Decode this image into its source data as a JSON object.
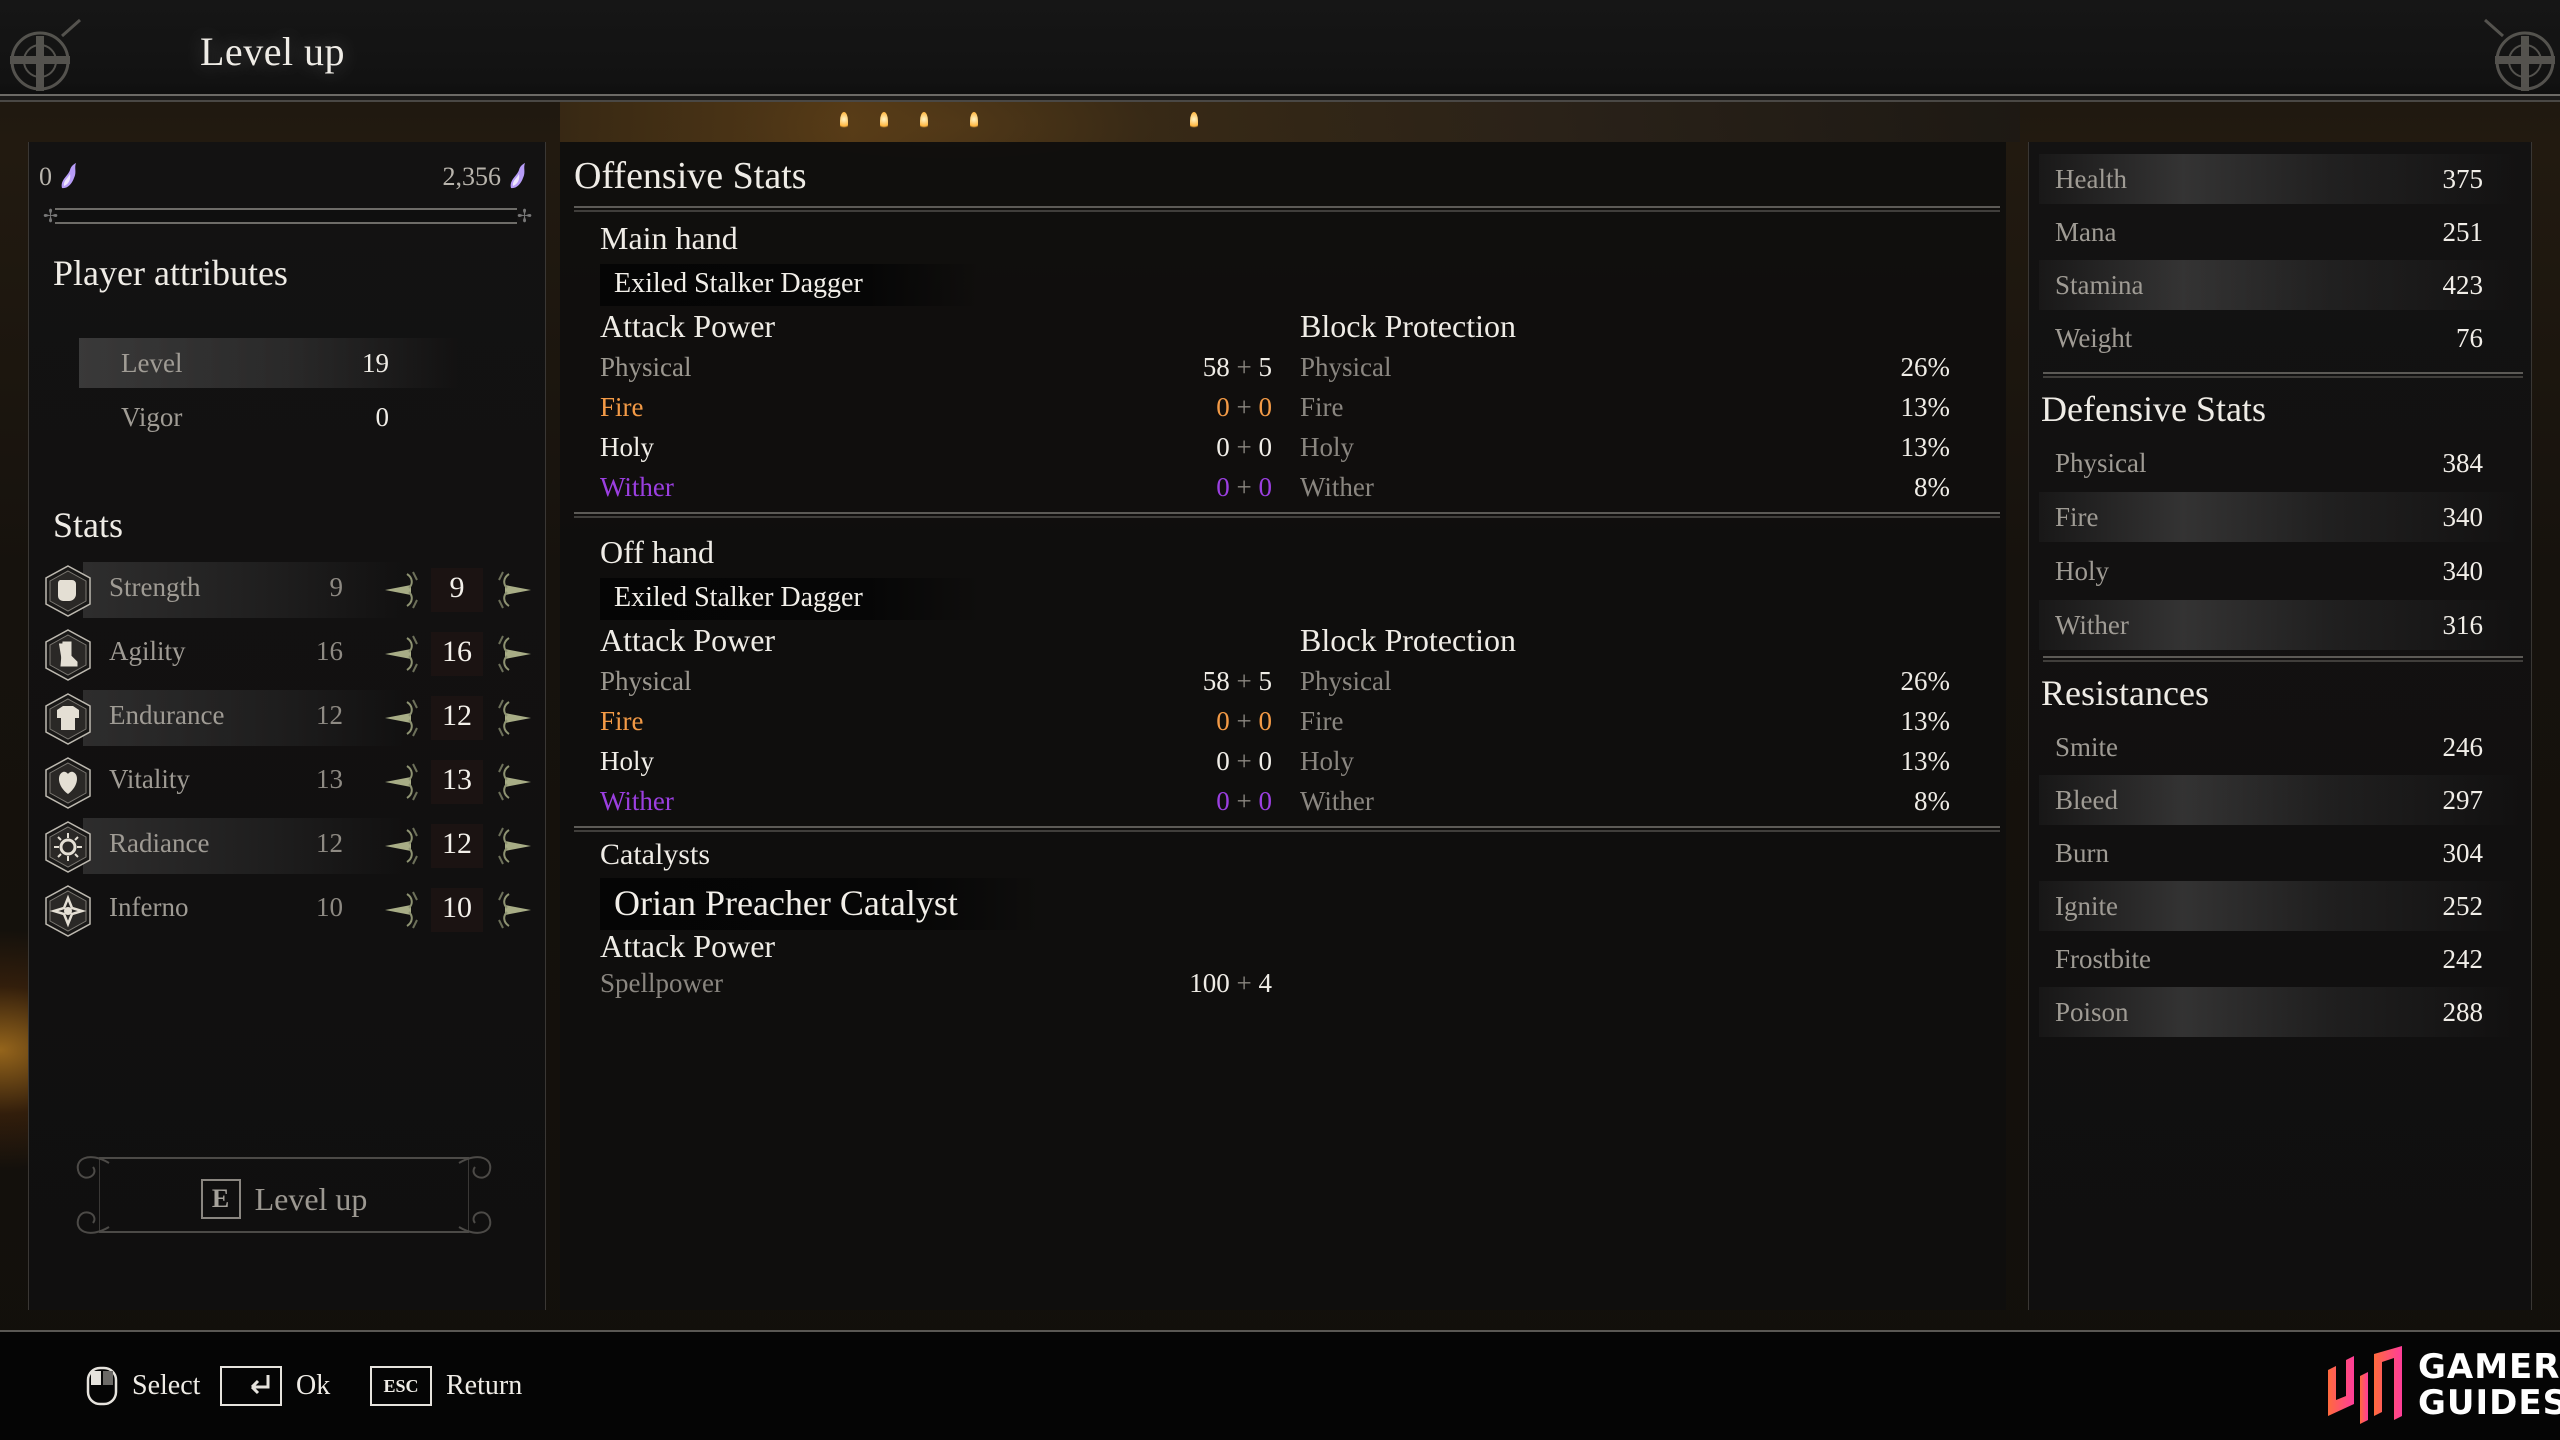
{
  "header": {
    "title": "Level up"
  },
  "currency": {
    "current_souls": "0",
    "required_souls": "2,356",
    "progress_fraction": 0.0,
    "icon": "soul-flame-icon",
    "accent": "#a98cf0"
  },
  "player_attributes": {
    "title": "Player attributes",
    "items": [
      {
        "label": "Level",
        "value": "19",
        "highlighted": true
      },
      {
        "label": "Vigor",
        "value": "0",
        "highlighted": false
      }
    ]
  },
  "stats": {
    "title": "Stats",
    "items": [
      {
        "label": "Strength",
        "base": "9",
        "current": "9",
        "icon": "fist-icon",
        "highlighted": true
      },
      {
        "label": "Agility",
        "base": "16",
        "current": "16",
        "icon": "boot-icon",
        "highlighted": false
      },
      {
        "label": "Endurance",
        "base": "12",
        "current": "12",
        "icon": "armor-icon",
        "highlighted": true
      },
      {
        "label": "Vitality",
        "base": "13",
        "current": "13",
        "icon": "heart-icon",
        "highlighted": false
      },
      {
        "label": "Radiance",
        "base": "12",
        "current": "12",
        "icon": "sun-icon",
        "highlighted": true
      },
      {
        "label": "Inferno",
        "base": "10",
        "current": "10",
        "icon": "flame-swirl-icon",
        "highlighted": false
      }
    ]
  },
  "level_up_button": {
    "key": "E",
    "label": "Level up"
  },
  "offensive": {
    "title": "Offensive Stats",
    "main_hand": {
      "title": "Main hand",
      "weapon": "Exiled Stalker Dagger",
      "attack_power_title": "Attack Power",
      "attack_power": [
        {
          "label": "Physical",
          "base": "58",
          "bonus": "5",
          "type": "physical"
        },
        {
          "label": "Fire",
          "base": "0",
          "bonus": "0",
          "type": "fire"
        },
        {
          "label": "Holy",
          "base": "0",
          "bonus": "0",
          "type": "holy"
        },
        {
          "label": "Wither",
          "base": "0",
          "bonus": "0",
          "type": "wither"
        }
      ],
      "block_title": "Block Protection",
      "block": [
        {
          "label": "Physical",
          "value": "26%"
        },
        {
          "label": "Fire",
          "value": "13%"
        },
        {
          "label": "Holy",
          "value": "13%"
        },
        {
          "label": "Wither",
          "value": "8%"
        }
      ]
    },
    "off_hand": {
      "title": "Off hand",
      "weapon": "Exiled Stalker Dagger",
      "attack_power_title": "Attack Power",
      "attack_power": [
        {
          "label": "Physical",
          "base": "58",
          "bonus": "5",
          "type": "physical"
        },
        {
          "label": "Fire",
          "base": "0",
          "bonus": "0",
          "type": "fire"
        },
        {
          "label": "Holy",
          "base": "0",
          "bonus": "0",
          "type": "holy"
        },
        {
          "label": "Wither",
          "base": "0",
          "bonus": "0",
          "type": "wither"
        }
      ],
      "block_title": "Block Protection",
      "block": [
        {
          "label": "Physical",
          "value": "26%"
        },
        {
          "label": "Fire",
          "value": "13%"
        },
        {
          "label": "Holy",
          "value": "13%"
        },
        {
          "label": "Wither",
          "value": "8%"
        }
      ]
    },
    "catalysts": {
      "title": "Catalysts",
      "weapon": "Orian Preacher Catalyst",
      "attack_power_title": "Attack Power",
      "attack_power": [
        {
          "label": "Spellpower",
          "base": "100",
          "bonus": "4",
          "type": "physical"
        }
      ]
    },
    "colors": {
      "physical": "#9b978f",
      "fire": "#f39a46",
      "holy": "#f1eee8",
      "wither": "#9b3fe0"
    }
  },
  "general": {
    "items": [
      {
        "label": "Health",
        "value": "375",
        "highlighted": true
      },
      {
        "label": "Mana",
        "value": "251",
        "highlighted": false
      },
      {
        "label": "Stamina",
        "value": "423",
        "highlighted": true
      },
      {
        "label": "Weight",
        "value": "76",
        "highlighted": false
      }
    ]
  },
  "defensive": {
    "title": "Defensive Stats",
    "items": [
      {
        "label": "Physical",
        "value": "384",
        "highlighted": false
      },
      {
        "label": "Fire",
        "value": "340",
        "highlighted": true
      },
      {
        "label": "Holy",
        "value": "340",
        "highlighted": false
      },
      {
        "label": "Wither",
        "value": "316",
        "highlighted": true
      }
    ]
  },
  "resistances": {
    "title": "Resistances",
    "items": [
      {
        "label": "Smite",
        "value": "246",
        "highlighted": false
      },
      {
        "label": "Bleed",
        "value": "297",
        "highlighted": true
      },
      {
        "label": "Burn",
        "value": "304",
        "highlighted": false
      },
      {
        "label": "Ignite",
        "value": "252",
        "highlighted": true
      },
      {
        "label": "Frostbite",
        "value": "242",
        "highlighted": false
      },
      {
        "label": "Poison",
        "value": "288",
        "highlighted": true
      }
    ]
  },
  "footer": {
    "hints": [
      {
        "icon": "mouse-icon",
        "label": "Select"
      },
      {
        "icon": "enter-key-icon",
        "label": "Ok"
      },
      {
        "icon": "esc-key-icon",
        "key": "ESC",
        "label": "Return"
      }
    ],
    "logo": {
      "line1": "GAMER",
      "line2": "GUIDES",
      "color_start": "#ff6a3d",
      "color_end": "#ff3d9a"
    }
  }
}
